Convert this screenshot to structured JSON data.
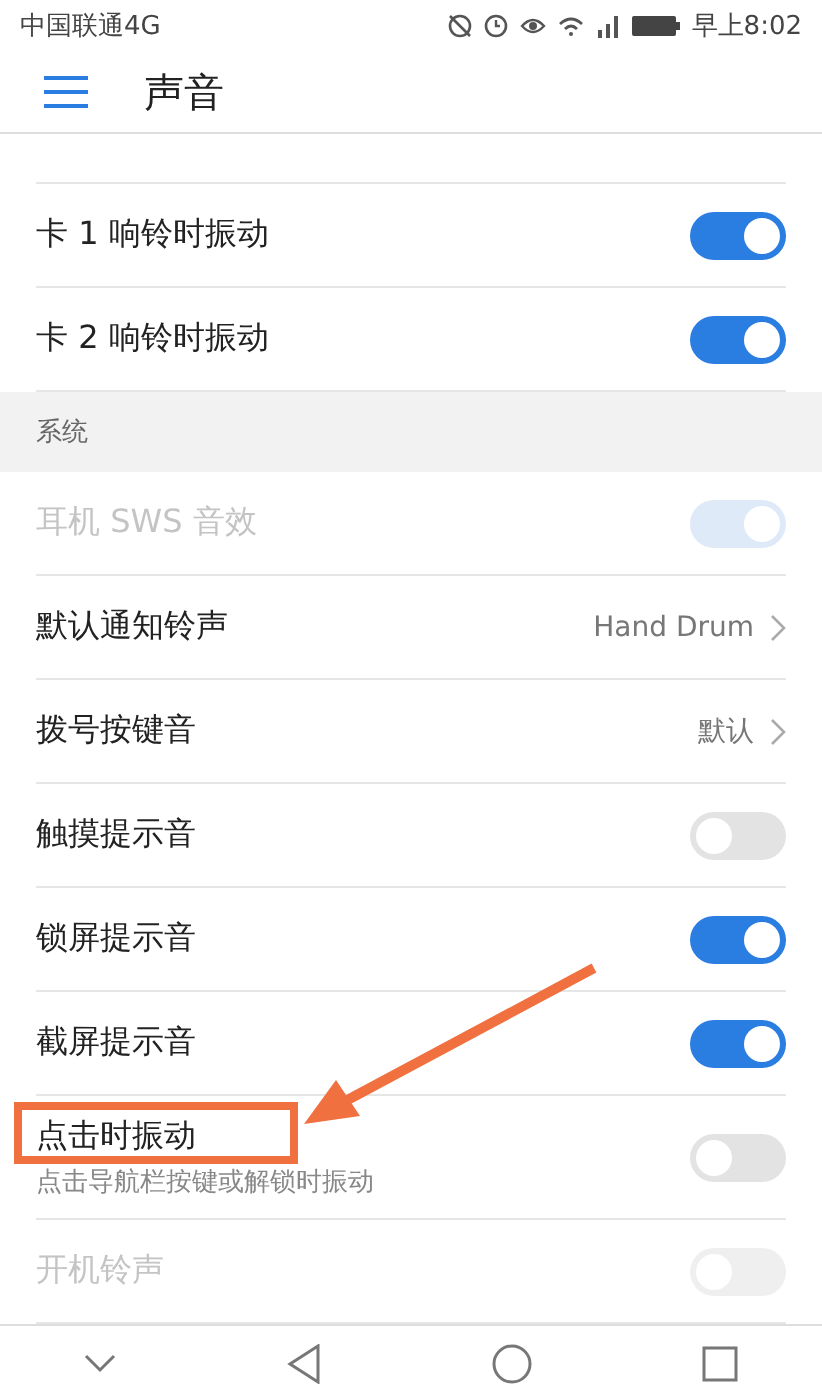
{
  "status_bar": {
    "carrier": "中国联通4G",
    "time": "早上8:02"
  },
  "header": {
    "title": "声音"
  },
  "rows": [
    {
      "kind": "switch",
      "label": "卡 1 响铃时振动",
      "on": true,
      "disabled": false
    },
    {
      "kind": "switch",
      "label": "卡 2 响铃时振动",
      "on": true,
      "disabled": false
    },
    {
      "kind": "section",
      "label": "系统"
    },
    {
      "kind": "switch",
      "label": "耳机 SWS 音效",
      "on": true,
      "disabled": true
    },
    {
      "kind": "link",
      "label": "默认通知铃声",
      "value": "Hand Drum"
    },
    {
      "kind": "link",
      "label": "拨号按键音",
      "value": "默认"
    },
    {
      "kind": "switch",
      "label": "触摸提示音",
      "on": false,
      "disabled": false
    },
    {
      "kind": "switch",
      "label": "锁屏提示音",
      "on": true,
      "disabled": false
    },
    {
      "kind": "switch",
      "label": "截屏提示音",
      "on": true,
      "disabled": false
    },
    {
      "kind": "switch",
      "label": "点击时振动",
      "subtitle": "点击导航栏按键或解锁时振动",
      "on": false,
      "disabled": false
    },
    {
      "kind": "switch",
      "label": "开机铃声",
      "on": false,
      "disabled": true
    }
  ]
}
